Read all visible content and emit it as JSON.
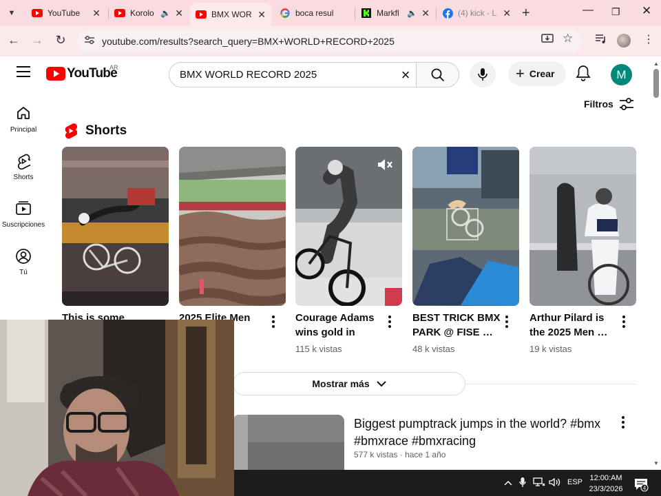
{
  "browser": {
    "tabs": [
      {
        "title": "YouTube",
        "favicon": "youtube-icon",
        "audio": false,
        "active": false
      },
      {
        "title": "Korolo",
        "favicon": "youtube-icon",
        "audio": true,
        "active": false
      },
      {
        "title": "BMX WOR",
        "favicon": "youtube-icon",
        "audio": false,
        "active": true
      },
      {
        "title": "boca resul",
        "favicon": "google-icon",
        "audio": false,
        "active": false
      },
      {
        "title": "Markfl",
        "favicon": "kick-icon",
        "audio": true,
        "active": false
      },
      {
        "title": "(4) kick - L",
        "favicon": "facebook-icon",
        "audio": false,
        "active": false
      }
    ],
    "url": "youtube.com/results?search_query=BMX+WORLD+RECORD+2025"
  },
  "youtube": {
    "logo_text": "YouTube",
    "country_code": "AR",
    "search_value": "BMX WORLD RECORD 2025",
    "create_label": "Crear",
    "avatar_letter": "M",
    "filters_label": "Filtros",
    "guide": [
      {
        "label": "Principal",
        "icon": "home-icon"
      },
      {
        "label": "Shorts",
        "icon": "shorts-icon"
      },
      {
        "label": "Suscripciones",
        "icon": "subscriptions-icon"
      },
      {
        "label": "Tú",
        "icon": "you-icon"
      }
    ],
    "shorts_title": "Shorts",
    "shorts": [
      {
        "title": "This is some",
        "views": ""
      },
      {
        "title": "2025 Elite Men",
        "views": "s"
      },
      {
        "title": "Courage Adams wins gold in BM…",
        "views": "115 k vistas"
      },
      {
        "title": "BEST TRICK BMX PARK @ FISE …",
        "views": "48 k vistas"
      },
      {
        "title": "Arthur Pilard is the 2025 Men …",
        "views": "19 k vistas"
      }
    ],
    "show_more_label": "Mostrar más",
    "video": {
      "title": "Biggest pumptrack jumps in the world? #bmx #bmxrace #bmxracing",
      "views": "577 k vistas",
      "age": "hace 1 año"
    }
  },
  "taskbar": {
    "language": "ESP",
    "time": "12:00:AM",
    "date": "23/3/2026",
    "notifications": "4"
  }
}
